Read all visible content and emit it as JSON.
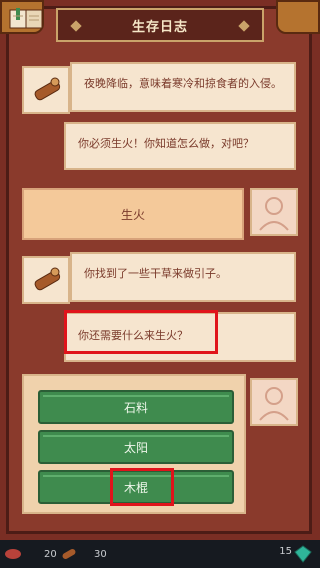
{
  "header": {
    "title": "生存日志"
  },
  "log": [
    {
      "speaker": "narrator",
      "icon": "log-wood-icon",
      "text": "夜晚降临，意味着寒冷和掠食者的入侵。"
    },
    {
      "speaker": "narrator",
      "text": "你必须生火！你知道怎么做，对吧？"
    },
    {
      "speaker": "player",
      "text": "生火"
    },
    {
      "speaker": "narrator",
      "icon": "log-wood-icon",
      "text": "你找到了一些干草来做引子。"
    },
    {
      "speaker": "narrator",
      "text": "你还需要什么来生火？"
    }
  ],
  "choices": [
    {
      "label": "石料"
    },
    {
      "label": "太阳"
    },
    {
      "label": "木棍"
    }
  ],
  "footer": {
    "resources": [
      {
        "icon": "meat-icon",
        "value": "20"
      },
      {
        "icon": "wood-icon",
        "value": "30"
      }
    ],
    "gems": "15"
  },
  "colors": {
    "frame": "#7a2e24",
    "bubble": "#f6e5cf",
    "player_bubble": "#f4c99a",
    "choice_button": "#3f8b4e",
    "highlight": "#e0141b"
  }
}
